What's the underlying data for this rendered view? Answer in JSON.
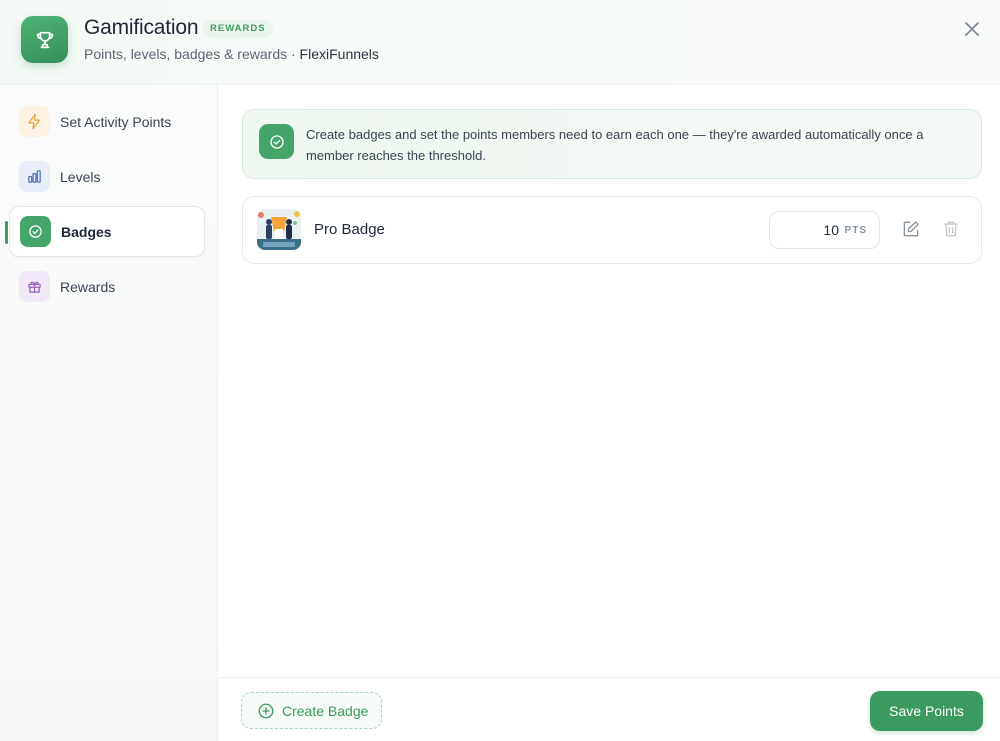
{
  "header": {
    "title": "Gamification",
    "title_badge": "REWARDS",
    "subtitle": "Points, levels, badges & rewards · ",
    "brand": "FlexiFunnels",
    "app_icon": "trophy-icon",
    "close_icon": "close-icon"
  },
  "sidebar": {
    "items": [
      {
        "label": "Set Activity Points",
        "icon": "lightning-icon",
        "active": false
      },
      {
        "label": "Levels",
        "icon": "bar-chart-icon",
        "active": false
      },
      {
        "label": "Badges",
        "icon": "check-badge-icon",
        "active": true
      },
      {
        "label": "Rewards",
        "icon": "gift-icon",
        "active": false
      }
    ]
  },
  "main": {
    "info": {
      "icon": "check-badge-icon",
      "text": "Create badges and set the points members need to earn each one — they're awarded automatically once a member reaches the threshold."
    },
    "badges": [
      {
        "name": "Pro Badge",
        "points": "10",
        "unit": "PTS",
        "edit_icon": "edit-icon",
        "delete_icon": "trash-icon"
      }
    ]
  },
  "footer": {
    "create_label": "Create Badge",
    "save_label": "Save Points"
  },
  "colors": {
    "accent": "#3a9a5f",
    "accent_light": "#eaf5ee"
  }
}
